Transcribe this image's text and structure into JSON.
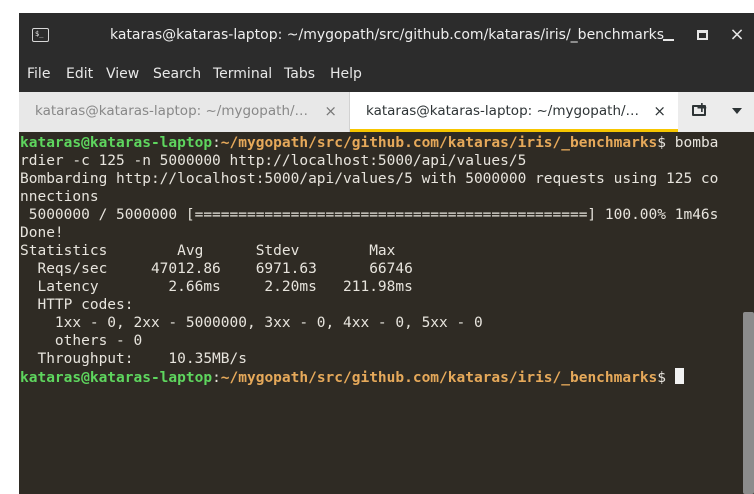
{
  "window": {
    "title": "kataras@kataras-laptop: ~/mygopath/src/github.com/kataras/iris/_benchmarks",
    "icon_label": "$_",
    "buttons": {
      "minimize": "minimize-icon",
      "maximize": "maximize-icon",
      "close": "×"
    }
  },
  "menu": {
    "items": [
      "File",
      "Edit",
      "View",
      "Search",
      "Terminal",
      "Tabs",
      "Help"
    ]
  },
  "tabs": [
    {
      "label": "kataras@kataras-laptop: ~/mygopath/src/github.com/kataras/iris/_benchmarks",
      "close": "×",
      "active": false
    },
    {
      "label": "kataras@kataras-laptop: ~/mygopath/src/github.com/kataras/iris/_benchmarks",
      "close": "×",
      "active": true
    }
  ],
  "terminal": {
    "prompt_user": "kataras@kataras-laptop",
    "prompt_sep": ":",
    "prompt_path": "~/mygopath/src/github.com/kataras/iris/_benchmarks",
    "prompt_symbol": "$ ",
    "command_start": "bomba",
    "lines": [
      "rdier -c 125 -n 5000000 http://localhost:5000/api/values/5",
      "Bombarding http://localhost:5000/api/values/5 with 5000000 requests using 125 co",
      "nnections",
      " 5000000 / 5000000 [=============================================] 100.00% 1m46s",
      "Done!",
      "Statistics        Avg      Stdev        Max",
      "  Reqs/sec     47012.86    6971.63      66746",
      "  Latency        2.66ms     2.20ms   211.98ms",
      "  HTTP codes:",
      "    1xx - 0, 2xx - 5000000, 3xx - 0, 4xx - 0, 5xx - 0",
      "    others - 0",
      "  Throughput:    10.35MB/s"
    ]
  },
  "colors": {
    "terminal_bg": "#2f2b24",
    "prompt_user": "#5ed65e",
    "prompt_path": "#e6a95a",
    "active_tab_accent": "#f7c600"
  }
}
